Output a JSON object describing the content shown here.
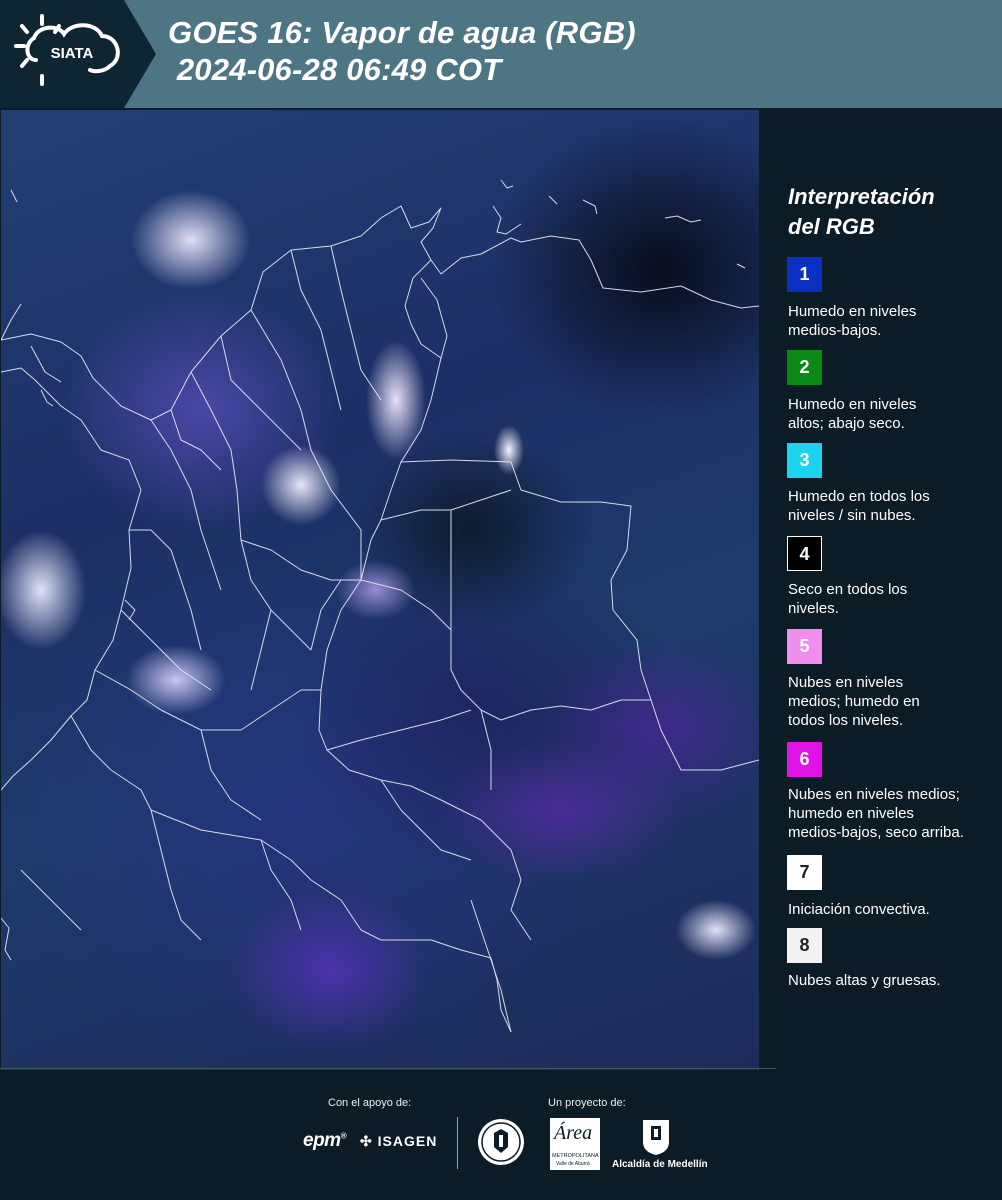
{
  "header": {
    "logo_text": "SIATA",
    "title_line1": "GOES 16: Vapor de agua (RGB)",
    "title_line2": " 2024-06-28 06:49 COT"
  },
  "legend": {
    "title_line1": "Interpretación",
    "title_line2": "del RGB",
    "items": [
      {
        "num": "1",
        "color": "#0a2fc4",
        "lines": [
          "Humedo en niveles",
          "medios-bajos."
        ]
      },
      {
        "num": "2",
        "color": "#0a8a14",
        "lines": [
          "Humedo en niveles",
          "altos; abajo seco."
        ]
      },
      {
        "num": "3",
        "color": "#1ed3f0",
        "lines": [
          "Humedo en todos los",
          "niveles / sin nubes."
        ]
      },
      {
        "num": "4",
        "color": "#000000",
        "lines": [
          "Seco en todos los",
          "niveles."
        ]
      },
      {
        "num": "5",
        "color": "#f08ef0",
        "lines": [
          "Nubes en niveles",
          "medios; humedo en",
          "todos los niveles."
        ]
      },
      {
        "num": "6",
        "color": "#e012e8",
        "lines": [
          "Nubes en niveles medios;",
          "humedo en niveles",
          "medios-bajos, seco arriba."
        ]
      },
      {
        "num": "7",
        "color": "#ffffff",
        "lines": [
          "Iniciación convectiva."
        ]
      },
      {
        "num": "8",
        "color": "#f2f2f2",
        "lines": [
          "Nubes altas y gruesas."
        ]
      }
    ]
  },
  "footer": {
    "support_label": "Con el apoyo de:",
    "project_label": "Un proyecto de:",
    "epm": "epm",
    "isagen": "ISAGEN",
    "area_name": "Área",
    "area_sub1": "METROPOLITANA",
    "area_sub2": "Valle de Aburrá",
    "alcaldia": "Alcaldía de Medellín"
  }
}
